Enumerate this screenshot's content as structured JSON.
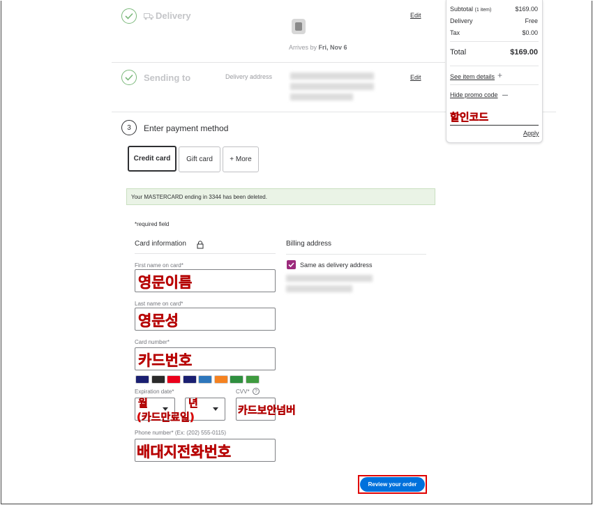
{
  "delivery": {
    "title": "Delivery",
    "arrives_prefix": "Arrives by",
    "arrives_date": "Fri, Nov 6",
    "edit": "Edit"
  },
  "sending_to": {
    "title": "Sending to",
    "address_label": "Delivery address",
    "edit": "Edit"
  },
  "payment": {
    "step_number": "3",
    "title": "Enter payment method",
    "tabs": [
      "Credit card",
      "Gift card",
      "+ More"
    ],
    "alert": "Your MASTERCARD ending in 3344 has been deleted.",
    "required_note": "*required field",
    "card_info_heading": "Card information",
    "billing_heading": "Billing address",
    "same_as_delivery": "Same as delivery address",
    "first_name_label": "First name on card*",
    "last_name_label": "Last name on card*",
    "card_number_label": "Card number*",
    "expiration_label": "Expiration date*",
    "cvv_label": "CVV*",
    "phone_label": "Phone number* (Ex: (202) 555-0115)",
    "review_button": "Review your order"
  },
  "card_logos": [
    {
      "name": "card-logo-1",
      "color": "#1a1f71"
    },
    {
      "name": "card-logo-2",
      "color": "#2a2a2a"
    },
    {
      "name": "card-logo-3",
      "color": "#eb001b"
    },
    {
      "name": "card-logo-4",
      "color": "#1a1f71"
    },
    {
      "name": "card-logo-5",
      "color": "#2e77bc"
    },
    {
      "name": "card-logo-6",
      "color": "#f58220"
    },
    {
      "name": "card-logo-7",
      "color": "#2f8f3f"
    },
    {
      "name": "card-logo-8",
      "color": "#3f9b3f"
    }
  ],
  "summary": {
    "subtotal_label": "Subtotal",
    "subtotal_items": "(1 item)",
    "subtotal_value": "$169.00",
    "delivery_label": "Delivery",
    "delivery_value": "Free",
    "tax_label": "Tax",
    "tax_value": "$0.00",
    "total_label": "Total",
    "total_value": "$169.00",
    "see_item_details": "See item details",
    "hide_promo": "Hide promo code",
    "apply": "Apply"
  },
  "annotations": {
    "promo_code": "할인코드",
    "first_name": "영문이름",
    "last_name": "영문성",
    "card_number": "카드번호",
    "month": "월",
    "expiry_note": "(카드만료일)",
    "year": "년",
    "cvv": "카드보안넘버",
    "phone": "배대지전화번호"
  },
  "colors": {
    "primary_button": "#0071dc",
    "annotation": "#e60000",
    "check_green": "#7ab87a",
    "alert_bg": "#eaf3e6",
    "checkbox": "#9c2a7c"
  }
}
